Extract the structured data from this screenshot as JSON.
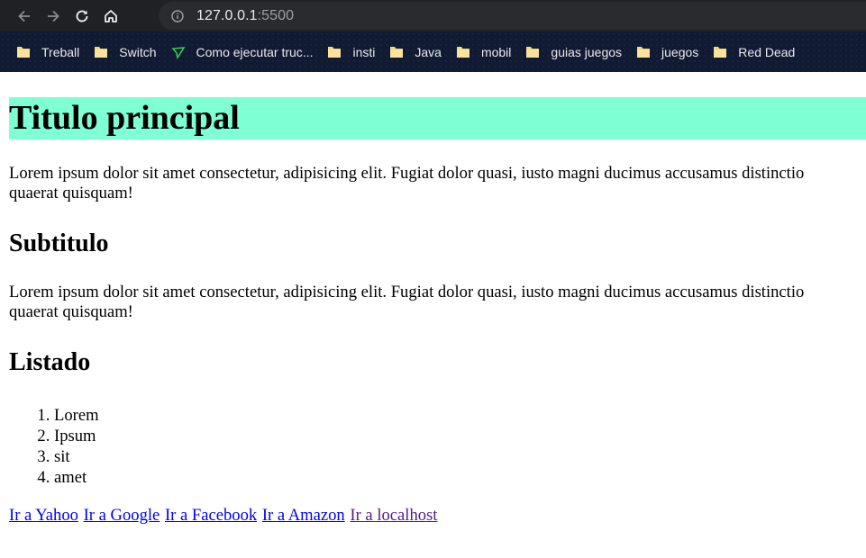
{
  "browser": {
    "url_host": "127.0.0.1",
    "url_port": ":5500",
    "bookmarks": [
      {
        "label": "Treball",
        "icon": "folder-icon"
      },
      {
        "label": "Switch",
        "icon": "folder-icon"
      },
      {
        "label": "Como ejecutar truc...",
        "icon": "site-favicon"
      },
      {
        "label": "insti",
        "icon": "folder-icon"
      },
      {
        "label": "Java",
        "icon": "folder-icon"
      },
      {
        "label": "mobil",
        "icon": "folder-icon"
      },
      {
        "label": "guias juegos",
        "icon": "folder-icon"
      },
      {
        "label": "juegos",
        "icon": "folder-icon"
      },
      {
        "label": "Red Dead",
        "icon": "folder-icon"
      }
    ]
  },
  "page": {
    "title": "Titulo principal",
    "paragraph1": {
      "line1": "Lorem ipsum dolor sit amet consectetur, adipisicing elit. Fugiat dolor quasi, iusto magni ducimus accusamus distinctio",
      "line2": "quaerat quisquam!"
    },
    "subtitle": "Subtitulo",
    "paragraph2": {
      "line1": "Lorem ipsum dolor sit amet consectetur, adipisicing elit. Fugiat dolor quasi, iusto magni ducimus accusamus distinctio",
      "line2": "quaerat quisquam!"
    },
    "list_heading": "Listado",
    "list_items": [
      "Lorem",
      "Ipsum",
      "sit",
      "amet"
    ],
    "links": [
      "Ir a Yahoo",
      "Ir a Google",
      "Ir a Facebook",
      "Ir a Amazon",
      "Ir a localhost"
    ]
  },
  "colors": {
    "title_background": "#7fffd4",
    "link": "#0000ee",
    "visited_link": "#551a8b"
  }
}
